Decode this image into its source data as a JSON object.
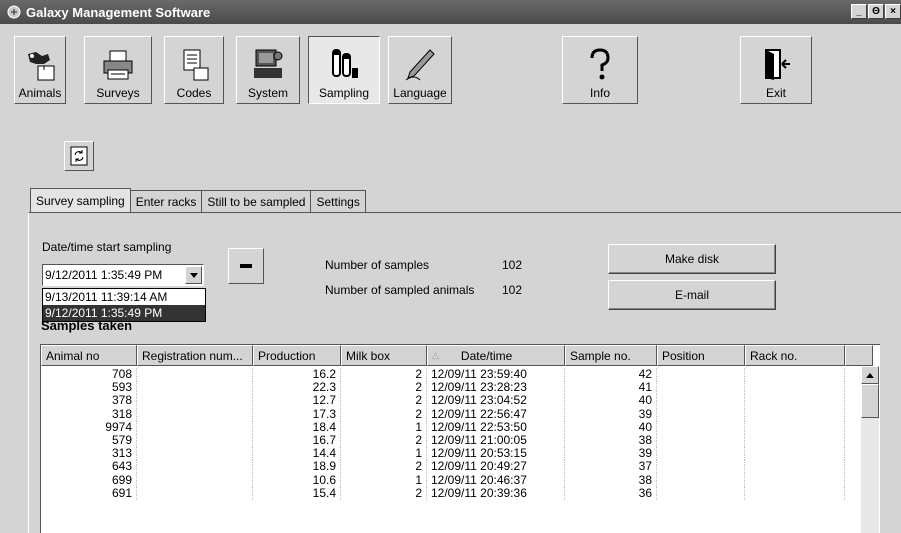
{
  "window": {
    "title": "Galaxy Management Software",
    "controls": [
      "_",
      "Θ",
      "×"
    ]
  },
  "toolbar": [
    {
      "label": "Animals",
      "icon": "cow-icon"
    },
    {
      "label": "Surveys",
      "icon": "printer-icon"
    },
    {
      "label": "Codes",
      "icon": "document-icon"
    },
    {
      "label": "System",
      "icon": "computer-icon"
    },
    {
      "label": "Sampling",
      "icon": "test-tubes-icon"
    },
    {
      "label": "Language",
      "icon": "pen-icon"
    },
    {
      "label": "Info",
      "icon": "question-icon"
    },
    {
      "label": "Exit",
      "icon": "exit-door-icon"
    }
  ],
  "tabs": [
    "Survey sampling",
    "Enter racks",
    "Still to be sampled",
    "Settings"
  ],
  "form": {
    "date_label": "Date/time start sampling",
    "date_value": "9/12/2011 1:35:49 PM",
    "dropdown_options": [
      "9/13/2011 11:39:14 AM",
      "9/12/2011 1:35:49 PM"
    ],
    "num_samples_label": "Number of samples",
    "num_samples_value": "102",
    "num_animals_label": "Number of sampled animals",
    "num_animals_value": "102",
    "make_disk": "Make disk",
    "email": "E-mail",
    "samples_taken": "Samples taken"
  },
  "table": {
    "sort_indicator": "△",
    "columns": [
      "Animal no",
      "Registration num...",
      "Production",
      "Milk box",
      "Date/time",
      "Sample no.",
      "Position",
      "Rack no."
    ],
    "rows": [
      [
        "708",
        "",
        "16.2",
        "2",
        "12/09/11 23:59:40",
        "42",
        "",
        ""
      ],
      [
        "593",
        "",
        "22.3",
        "2",
        "12/09/11 23:28:23",
        "41",
        "",
        ""
      ],
      [
        "378",
        "",
        "12.7",
        "2",
        "12/09/11 23:04:52",
        "40",
        "",
        ""
      ],
      [
        "318",
        "",
        "17.3",
        "2",
        "12/09/11 22:56:47",
        "39",
        "",
        ""
      ],
      [
        "9974",
        "",
        "18.4",
        "1",
        "12/09/11 22:53:50",
        "40",
        "",
        ""
      ],
      [
        "579",
        "",
        "16.7",
        "2",
        "12/09/11 21:00:05",
        "38",
        "",
        ""
      ],
      [
        "313",
        "",
        "14.4",
        "1",
        "12/09/11 20:53:15",
        "39",
        "",
        ""
      ],
      [
        "643",
        "",
        "18.9",
        "2",
        "12/09/11 20:49:27",
        "37",
        "",
        ""
      ],
      [
        "699",
        "",
        "10.6",
        "1",
        "12/09/11 20:46:37",
        "38",
        "",
        ""
      ],
      [
        "691",
        "",
        "15.4",
        "2",
        "12/09/11 20:39:36",
        "36",
        "",
        ""
      ]
    ]
  }
}
